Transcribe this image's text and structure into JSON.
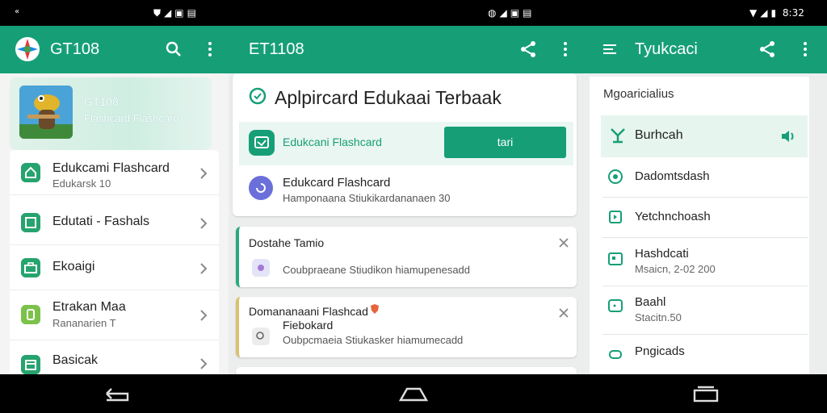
{
  "status_bar": {
    "left_glyph": "«",
    "mid_time": "",
    "right_time": "8:32"
  },
  "colors": {
    "accent": "#169f77",
    "accent_light": "#eaf6f1",
    "notif_green_bar": "#2aa97a",
    "notif_yellow_bar": "#d8c272"
  },
  "panel_left": {
    "app_title": "GT108",
    "hero": {
      "title": "GT108",
      "subtitle": "Flashcard Flashcard"
    },
    "items": [
      {
        "title": "Edukcami Flashcard",
        "subtitle": "Edukarsk 10"
      },
      {
        "title": "Edutati - Fashals",
        "subtitle": ""
      },
      {
        "title": "Ekoaigi",
        "subtitle": ""
      },
      {
        "title": "Etrakan Maa",
        "subtitle": "Rananarien T"
      },
      {
        "title": "Basicak",
        "subtitle": ""
      }
    ]
  },
  "panel_middle": {
    "app_title": "ET1108",
    "big_title": "Aplpircard Edukaai Terbaak",
    "highlight_item": {
      "label": "Edukcani Flashcard",
      "button_label": "tari"
    },
    "second_item": {
      "title": "Edukcard Flashcard",
      "subtitle": "Hamponaana Stiukikardananaen 30"
    },
    "notifications": [
      {
        "title": "Dostahe Tamio",
        "subtitle": "Coubpraeane Stiudikon hiamupenesadd"
      },
      {
        "title": "Domananaani Flashcad",
        "title2": "Fiebokard",
        "subtitle": "Oubpcmaeia Stiukasker hiamumecadd"
      }
    ]
  },
  "panel_right": {
    "app_title": "Tyukcaci",
    "section_label": "Mgoaricialius",
    "items": [
      {
        "title": "Burhcah",
        "subtitle": ""
      },
      {
        "title": "Dadomtsdash",
        "subtitle": ""
      },
      {
        "title": "Yetchnchoash",
        "subtitle": ""
      },
      {
        "title": "Hashdcati",
        "subtitle": "Msaicn, 2-02 200"
      },
      {
        "title": "Baahl",
        "subtitle": "Stacitn.50"
      },
      {
        "title": "Pngicads",
        "subtitle": ""
      }
    ]
  }
}
